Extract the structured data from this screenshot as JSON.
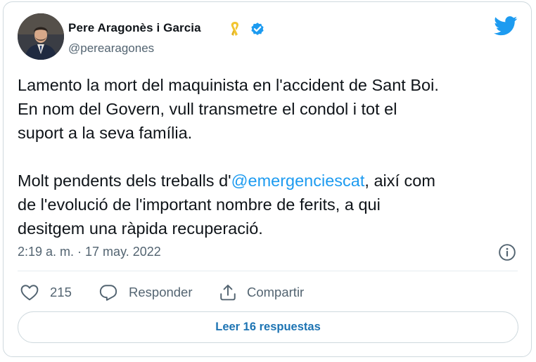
{
  "user": {
    "display_name": "Pere Aragonès i Garcia",
    "handle": "@perearagones"
  },
  "tweet": {
    "paragraph1": [
      "Lamento la mort del maquinista en l'accident de Sant Boi.",
      "En nom del Govern, vull transmetre el condol i tot el",
      "suport a la seva família."
    ],
    "paragraph2_line1_before": "Molt pendents dels treballs d'",
    "mention": "@emergenciescat",
    "paragraph2_line1_after": ", així com",
    "paragraph2_lines": [
      "de l'evolució de l'important nombre de ferits, a qui",
      "desitgem una ràpida recuperació."
    ],
    "timestamp": "2:19 a. m. · 17 may. 2022"
  },
  "actions": {
    "likes": "215",
    "reply_label": "Responder",
    "share_label": "Compartir"
  },
  "read_replies_label": "Leer 16 respuestas",
  "colors": {
    "accent": "#1d9bf0",
    "verified": "#1d9bf0",
    "ribbon": "#f2c530",
    "text": "#0f1419",
    "secondary": "#536471",
    "link_button": "#1d74b3"
  },
  "icons": {
    "ribbon": "yellow-ribbon-icon",
    "verified": "verified-badge-icon",
    "logo": "twitter-bird-icon",
    "info": "info-icon",
    "like": "heart-icon",
    "reply": "reply-bubble-icon",
    "share": "share-icon"
  }
}
